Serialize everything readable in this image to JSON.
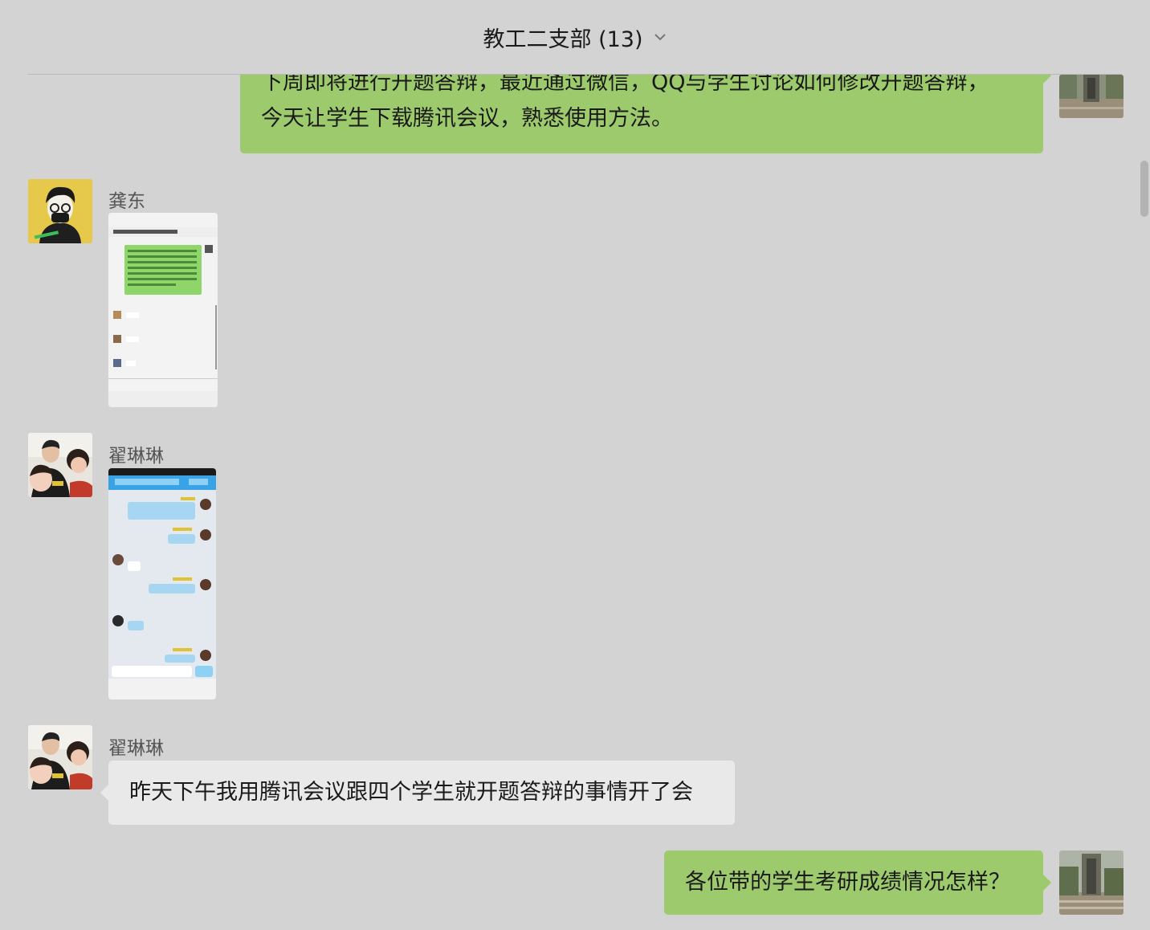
{
  "header": {
    "title": "教工二支部 (13)",
    "dropdown_icon": "chevron-down-icon"
  },
  "messages": [
    {
      "sender": "me",
      "type": "text",
      "text_line1": "下周即将进行开题答辩，最近通过微信，QQ与学生讨论如何修改开题答辩，",
      "text_line2": "今天让学生下载腾讯会议，熟悉使用方法。"
    },
    {
      "sender": "龚东",
      "type": "image",
      "image_desc": "screenshot-image"
    },
    {
      "sender": "翟琳琳",
      "type": "image",
      "image_desc": "screenshot-image"
    },
    {
      "sender": "翟琳琳",
      "type": "text",
      "text": "昨天下午我用腾讯会议跟四个学生就开题答辩的事情开了会"
    },
    {
      "sender": "me",
      "type": "text",
      "text": "各位带的学生考研成绩情况怎样？"
    }
  ],
  "colors": {
    "background": "#d3d3d3",
    "outgoing_bubble": "#9dca6c",
    "incoming_bubble": "#e9e9e9"
  }
}
